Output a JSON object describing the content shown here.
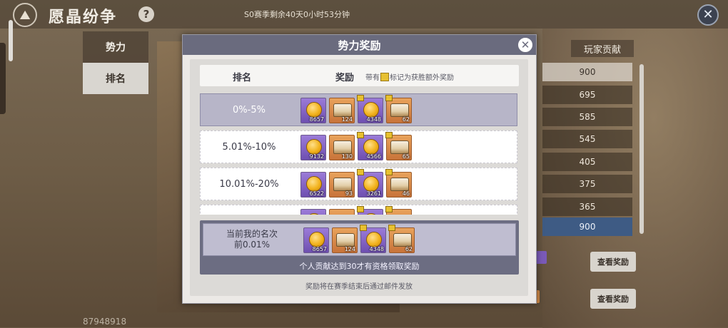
{
  "header": {
    "title": "愿晶纷争",
    "help_icon": "?",
    "season_timer": "S0赛季剩余40天0小时53分钟",
    "close_icon": "✕"
  },
  "sidebar": {
    "tabs": [
      {
        "label": "势力",
        "selected": false
      },
      {
        "label": "排名",
        "selected": true
      }
    ],
    "player_id": "87948918"
  },
  "right_panel": {
    "header": "玩家贡献",
    "values": [
      "900",
      "695",
      "585",
      "545",
      "405",
      "375",
      "365",
      "900"
    ],
    "view_buttons": [
      "查看奖励",
      "查看奖励"
    ]
  },
  "modal": {
    "title": "势力奖励",
    "close_icon": "✕",
    "col_rank": "排名",
    "col_reward": "奖励",
    "note_prefix": "带有",
    "note_suffix": "标记为获胜额外奖励",
    "rows": [
      {
        "rank": "0%-5%",
        "items": [
          {
            "type": "coin",
            "color": "purple",
            "qty": "8657",
            "bonus": false
          },
          {
            "type": "chest",
            "color": "orange",
            "qty": "124",
            "bonus": false
          },
          {
            "type": "coin",
            "color": "purple",
            "qty": "4348",
            "bonus": true
          },
          {
            "type": "chest",
            "color": "orange",
            "qty": "62",
            "bonus": true
          }
        ]
      },
      {
        "rank": "5.01%-10%",
        "items": [
          {
            "type": "coin",
            "color": "purple",
            "qty": "9132",
            "bonus": false
          },
          {
            "type": "chest",
            "color": "orange",
            "qty": "130",
            "bonus": false
          },
          {
            "type": "coin",
            "color": "purple",
            "qty": "4566",
            "bonus": true
          },
          {
            "type": "chest",
            "color": "orange",
            "qty": "65",
            "bonus": true
          }
        ]
      },
      {
        "rank": "10.01%-20%",
        "items": [
          {
            "type": "coin",
            "color": "purple",
            "qty": "6522",
            "bonus": false
          },
          {
            "type": "chest",
            "color": "orange",
            "qty": "93",
            "bonus": false
          },
          {
            "type": "coin",
            "color": "purple",
            "qty": "3261",
            "bonus": true
          },
          {
            "type": "chest",
            "color": "orange",
            "qty": "46",
            "bonus": true
          }
        ]
      },
      {
        "rank": "",
        "items": [
          {
            "type": "coin",
            "color": "purple",
            "qty": "",
            "bonus": false
          },
          {
            "type": "chest",
            "color": "orange",
            "qty": "",
            "bonus": false
          },
          {
            "type": "coin",
            "color": "purple",
            "qty": "",
            "bonus": true
          },
          {
            "type": "chest",
            "color": "orange",
            "qty": "",
            "bonus": true
          }
        ]
      }
    ],
    "my_rank_line1": "当前我的名次",
    "my_rank_line2": "前0.01%",
    "my_items": [
      {
        "type": "coin",
        "color": "purple",
        "qty": "8657",
        "bonus": false
      },
      {
        "type": "chest",
        "color": "orange",
        "qty": "124",
        "bonus": false
      },
      {
        "type": "coin",
        "color": "purple",
        "qty": "4348",
        "bonus": true
      },
      {
        "type": "chest",
        "color": "orange",
        "qty": "62",
        "bonus": true
      }
    ],
    "requirement_note": "个人贡献达到30才有资格领取奖励",
    "mail_note": "奖励将在赛季结束后通过邮件发放"
  },
  "colors": {
    "modal_title_bg": "#6a6b7e",
    "highlight_row": "#b7b5c8",
    "item_purple": "#8a6ac8",
    "item_orange": "#d98c48",
    "bonus_marker": "#e8c130"
  }
}
